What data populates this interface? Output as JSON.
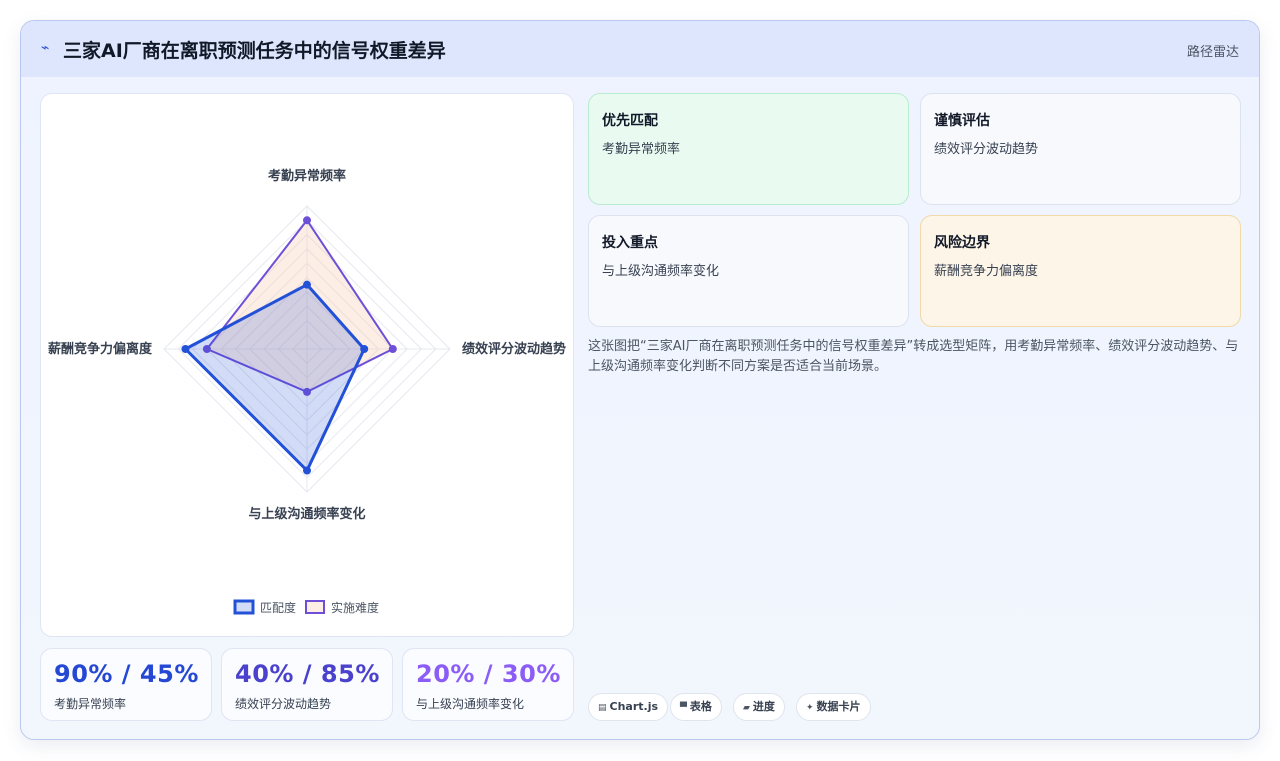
{
  "header": {
    "title": "三家AI厂商在离职预测任务中的信号权重差异",
    "tag": "路径雷达"
  },
  "chart_data": {
    "type": "radar",
    "axes": [
      "考勤异常频率",
      "绩效评分波动趋势",
      "与上级沟通频率变化",
      "薪酬竞争力偏离度"
    ],
    "range": [
      0,
      100
    ],
    "series": [
      {
        "name": "匹配度",
        "values": [
          45,
          40,
          85,
          85
        ],
        "color": "#2251d8"
      },
      {
        "name": "实施难度",
        "values": [
          90,
          60,
          30,
          70
        ],
        "color": "#6d4fd8"
      }
    ],
    "legend_position": "bottom"
  },
  "kpis": [
    {
      "value": "90% / 45%",
      "label": "考勤异常频率",
      "color": "#2548d4"
    },
    {
      "value": "40% / 85%",
      "label": "绩效评分波动趋势",
      "color": "#4a41cc"
    },
    {
      "value": "20% / 30%",
      "label": "与上级沟通频率变化",
      "color": "#8b5cf6"
    }
  ],
  "tiles": [
    {
      "title": "优先匹配",
      "desc": "考勤异常频率"
    },
    {
      "title": "谨慎评估",
      "desc": "绩效评分波动趋势"
    },
    {
      "title": "投入重点",
      "desc": "与上级沟通频率变化"
    },
    {
      "title": "风险边界",
      "desc": "薪酬竞争力偏离度"
    }
  ],
  "description": "这张图把“三家AI厂商在离职预测任务中的信号权重差异”转成选型矩阵，用考勤异常频率、绩效评分波动趋势、与上级沟通频率变化判断不同方案是否适合当前场景。",
  "chips": [
    {
      "icon": "chart-icon",
      "label": "Chart.js"
    },
    {
      "icon": "table-icon",
      "label": "表格"
    },
    {
      "icon": "progress-icon",
      "label": "进度"
    },
    {
      "icon": "card-icon",
      "label": "数据卡片"
    }
  ]
}
